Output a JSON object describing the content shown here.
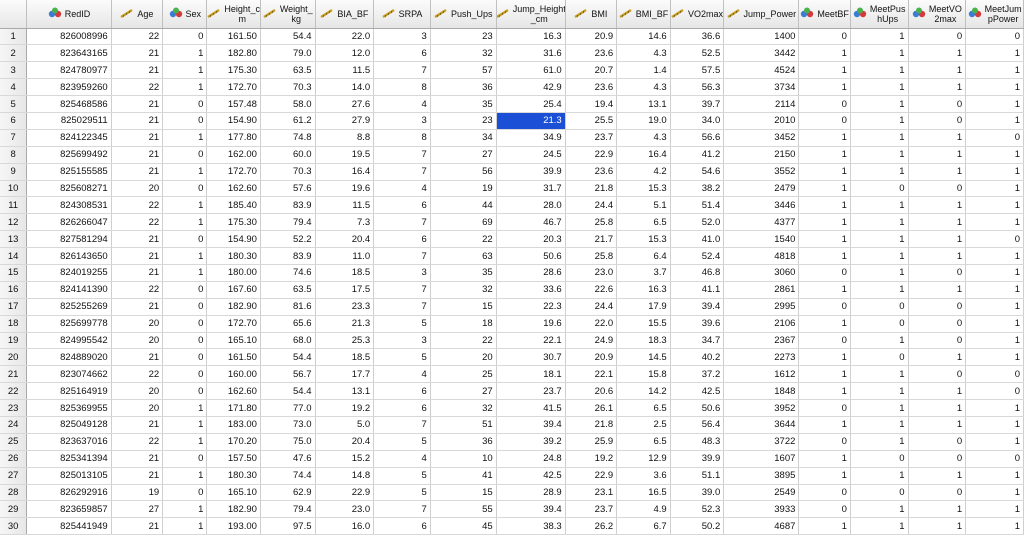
{
  "colors": {
    "selection": "#1a4fd6",
    "header_bg": "#eeeeee",
    "grid_line": "#d8d8d8"
  },
  "columns": [
    {
      "name": "RedID",
      "icon": "nominal-icon"
    },
    {
      "name": "Age",
      "icon": "scale-icon"
    },
    {
      "name": "Sex",
      "icon": "nominal-icon"
    },
    {
      "name": "Height_c\nm",
      "icon": "scale-icon"
    },
    {
      "name": "Weight_\nkg",
      "icon": "scale-icon"
    },
    {
      "name": "BIA_BF",
      "icon": "scale-icon"
    },
    {
      "name": "SRPA",
      "icon": "scale-icon"
    },
    {
      "name": "Push_Ups",
      "icon": "scale-icon"
    },
    {
      "name": "Jump_Height\n_cm",
      "icon": "scale-icon"
    },
    {
      "name": "BMI",
      "icon": "scale-icon"
    },
    {
      "name": "BMI_BF",
      "icon": "scale-icon"
    },
    {
      "name": "VO2max",
      "icon": "scale-icon"
    },
    {
      "name": "Jump_Power",
      "icon": "scale-icon"
    },
    {
      "name": "MeetBF",
      "icon": "nominal-icon"
    },
    {
      "name": "MeetPus\nhUps",
      "icon": "nominal-icon"
    },
    {
      "name": "MeetVO\n2max",
      "icon": "nominal-icon"
    },
    {
      "name": "MeetJum\npPower",
      "icon": "nominal-icon"
    }
  ],
  "rows": [
    [
      "1",
      "826008996",
      "22",
      "0",
      "161.50",
      "54.4",
      "22.0",
      "3",
      "23",
      "16.3",
      "20.9",
      "14.6",
      "36.6",
      "1400",
      "0",
      "1",
      "0",
      "0"
    ],
    [
      "2",
      "823643165",
      "21",
      "1",
      "182.80",
      "79.0",
      "12.0",
      "6",
      "32",
      "31.6",
      "23.6",
      "4.3",
      "52.5",
      "3442",
      "1",
      "1",
      "1",
      "1"
    ],
    [
      "3",
      "824780977",
      "21",
      "1",
      "175.30",
      "63.5",
      "11.5",
      "7",
      "57",
      "61.0",
      "20.7",
      "1.4",
      "57.5",
      "4524",
      "1",
      "1",
      "1",
      "1"
    ],
    [
      "4",
      "823959260",
      "22",
      "1",
      "172.70",
      "70.3",
      "14.0",
      "8",
      "36",
      "42.9",
      "23.6",
      "4.3",
      "56.3",
      "3734",
      "1",
      "1",
      "1",
      "1"
    ],
    [
      "5",
      "825468586",
      "21",
      "0",
      "157.48",
      "58.0",
      "27.6",
      "4",
      "35",
      "25.4",
      "19.4",
      "13.1",
      "39.7",
      "2114",
      "0",
      "1",
      "0",
      "1"
    ],
    [
      "6",
      "825029511",
      "21",
      "0",
      "154.90",
      "61.2",
      "27.9",
      "3",
      "23",
      "21.3",
      "25.5",
      "19.0",
      "34.0",
      "2010",
      "0",
      "1",
      "0",
      "1"
    ],
    [
      "7",
      "824122345",
      "21",
      "1",
      "177.80",
      "74.8",
      "8.8",
      "8",
      "34",
      "34.9",
      "23.7",
      "4.3",
      "56.6",
      "3452",
      "1",
      "1",
      "1",
      "0"
    ],
    [
      "8",
      "825699492",
      "21",
      "0",
      "162.00",
      "60.0",
      "19.5",
      "7",
      "27",
      "24.5",
      "22.9",
      "16.4",
      "41.2",
      "2150",
      "1",
      "1",
      "1",
      "1"
    ],
    [
      "9",
      "825155585",
      "21",
      "1",
      "172.70",
      "70.3",
      "16.4",
      "7",
      "56",
      "39.9",
      "23.6",
      "4.2",
      "54.6",
      "3552",
      "1",
      "1",
      "1",
      "1"
    ],
    [
      "10",
      "825608271",
      "20",
      "0",
      "162.60",
      "57.6",
      "19.6",
      "4",
      "19",
      "31.7",
      "21.8",
      "15.3",
      "38.2",
      "2479",
      "1",
      "0",
      "0",
      "1"
    ],
    [
      "11",
      "824308531",
      "22",
      "1",
      "185.40",
      "83.9",
      "11.5",
      "6",
      "44",
      "28.0",
      "24.4",
      "5.1",
      "51.4",
      "3446",
      "1",
      "1",
      "1",
      "1"
    ],
    [
      "12",
      "826266047",
      "22",
      "1",
      "175.30",
      "79.4",
      "7.3",
      "7",
      "69",
      "46.7",
      "25.8",
      "6.5",
      "52.0",
      "4377",
      "1",
      "1",
      "1",
      "1"
    ],
    [
      "13",
      "827581294",
      "21",
      "0",
      "154.90",
      "52.2",
      "20.4",
      "6",
      "22",
      "20.3",
      "21.7",
      "15.3",
      "41.0",
      "1540",
      "1",
      "1",
      "1",
      "0"
    ],
    [
      "14",
      "826143650",
      "21",
      "1",
      "180.30",
      "83.9",
      "11.0",
      "7",
      "63",
      "50.6",
      "25.8",
      "6.4",
      "52.4",
      "4818",
      "1",
      "1",
      "1",
      "1"
    ],
    [
      "15",
      "824019255",
      "21",
      "1",
      "180.00",
      "74.6",
      "18.5",
      "3",
      "35",
      "28.6",
      "23.0",
      "3.7",
      "46.8",
      "3060",
      "0",
      "1",
      "0",
      "1"
    ],
    [
      "16",
      "824141390",
      "22",
      "0",
      "167.60",
      "63.5",
      "17.5",
      "7",
      "32",
      "33.6",
      "22.6",
      "16.3",
      "41.1",
      "2861",
      "1",
      "1",
      "1",
      "1"
    ],
    [
      "17",
      "825255269",
      "21",
      "0",
      "182.90",
      "81.6",
      "23.3",
      "7",
      "15",
      "22.3",
      "24.4",
      "17.9",
      "39.4",
      "2995",
      "0",
      "0",
      "0",
      "1"
    ],
    [
      "18",
      "825699778",
      "20",
      "0",
      "172.70",
      "65.6",
      "21.3",
      "5",
      "18",
      "19.6",
      "22.0",
      "15.5",
      "39.6",
      "2106",
      "1",
      "0",
      "0",
      "1"
    ],
    [
      "19",
      "824995542",
      "20",
      "0",
      "165.10",
      "68.0",
      "25.3",
      "3",
      "22",
      "22.1",
      "24.9",
      "18.3",
      "34.7",
      "2367",
      "0",
      "1",
      "0",
      "1"
    ],
    [
      "20",
      "824889020",
      "21",
      "0",
      "161.50",
      "54.4",
      "18.5",
      "5",
      "20",
      "30.7",
      "20.9",
      "14.5",
      "40.2",
      "2273",
      "1",
      "0",
      "1",
      "1"
    ],
    [
      "21",
      "823074662",
      "22",
      "0",
      "160.00",
      "56.7",
      "17.7",
      "4",
      "25",
      "18.1",
      "22.1",
      "15.8",
      "37.2",
      "1612",
      "1",
      "1",
      "0",
      "0"
    ],
    [
      "22",
      "825164919",
      "20",
      "0",
      "162.60",
      "54.4",
      "13.1",
      "6",
      "27",
      "23.7",
      "20.6",
      "14.2",
      "42.5",
      "1848",
      "1",
      "1",
      "1",
      "0"
    ],
    [
      "23",
      "825369955",
      "20",
      "1",
      "171.80",
      "77.0",
      "19.2",
      "6",
      "32",
      "41.5",
      "26.1",
      "6.5",
      "50.6",
      "3952",
      "0",
      "1",
      "1",
      "1"
    ],
    [
      "24",
      "825049128",
      "21",
      "1",
      "183.00",
      "73.0",
      "5.0",
      "7",
      "51",
      "39.4",
      "21.8",
      "2.5",
      "56.4",
      "3644",
      "1",
      "1",
      "1",
      "1"
    ],
    [
      "25",
      "823637016",
      "22",
      "1",
      "170.20",
      "75.0",
      "20.4",
      "5",
      "36",
      "39.2",
      "25.9",
      "6.5",
      "48.3",
      "3722",
      "0",
      "1",
      "0",
      "1"
    ],
    [
      "26",
      "825341394",
      "21",
      "0",
      "157.50",
      "47.6",
      "15.2",
      "4",
      "10",
      "24.8",
      "19.2",
      "12.9",
      "39.9",
      "1607",
      "1",
      "0",
      "0",
      "0"
    ],
    [
      "27",
      "825013105",
      "21",
      "1",
      "180.30",
      "74.4",
      "14.8",
      "5",
      "41",
      "42.5",
      "22.9",
      "3.6",
      "51.1",
      "3895",
      "1",
      "1",
      "1",
      "1"
    ],
    [
      "28",
      "826292916",
      "19",
      "0",
      "165.10",
      "62.9",
      "22.9",
      "5",
      "15",
      "28.9",
      "23.1",
      "16.5",
      "39.0",
      "2549",
      "0",
      "0",
      "0",
      "1"
    ],
    [
      "29",
      "823659857",
      "27",
      "1",
      "182.90",
      "79.4",
      "23.0",
      "7",
      "55",
      "39.4",
      "23.7",
      "4.9",
      "52.3",
      "3933",
      "0",
      "1",
      "1",
      "1"
    ],
    [
      "30",
      "825441949",
      "21",
      "1",
      "193.00",
      "97.5",
      "16.0",
      "6",
      "45",
      "38.3",
      "26.2",
      "6.7",
      "50.2",
      "4687",
      "1",
      "1",
      "1",
      "1"
    ]
  ],
  "selected_cell": {
    "row": 6,
    "col": 9
  }
}
